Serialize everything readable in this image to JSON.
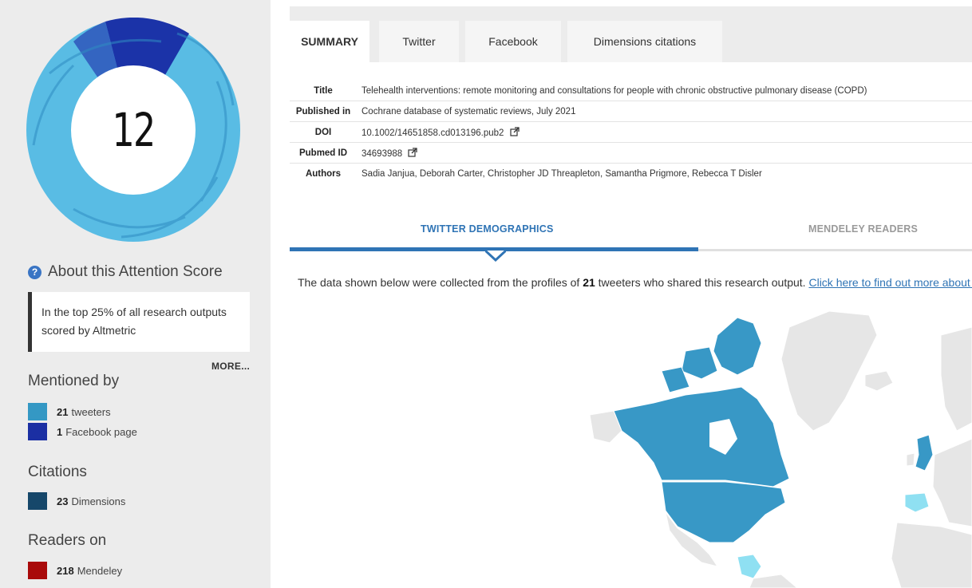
{
  "score": "12",
  "about_title": "About this Attention Score",
  "rank_text": "In the top 25% of all research outputs scored by Altmetric",
  "more_label": "MORE...",
  "mentioned": {
    "title": "Mentioned by",
    "items": [
      {
        "count": "21",
        "label": "tweeters",
        "color": "#3498c4"
      },
      {
        "count": "1",
        "label": "Facebook page",
        "color": "#1b2fa3"
      }
    ]
  },
  "citations": {
    "title": "Citations",
    "items": [
      {
        "count": "23",
        "label": "Dimensions",
        "color": "#16476a"
      }
    ]
  },
  "readers": {
    "title": "Readers on",
    "items": [
      {
        "count": "218",
        "label": "Mendeley",
        "color": "#a90a0a"
      }
    ]
  },
  "tabs": [
    "SUMMARY",
    "Twitter",
    "Facebook",
    "Dimensions citations"
  ],
  "info": [
    {
      "label": "Title",
      "value": "Telehealth interventions: remote monitoring and consultations for people with chronic obstructive pulmonary disease (COPD)"
    },
    {
      "label": "Published in",
      "value": "Cochrane database of systematic reviews, July 2021"
    },
    {
      "label": "DOI",
      "value": "10.1002/14651858.cd013196.pub2"
    },
    {
      "label": "Pubmed ID",
      "value": "34693988"
    },
    {
      "label": "Authors",
      "value": "Sadia Janjua, Deborah Carter, Christopher JD Threapleton, Samantha Prigmore, Rebecca T Disler"
    }
  ],
  "demo_tabs": [
    "TWITTER DEMOGRAPHICS",
    "MENDELEY READERS"
  ],
  "collected": {
    "prefix": "The data shown below were collected from the profiles of ",
    "count": "21",
    "suffix": " tweeters who shared this research output. ",
    "link": "Click here to find out more about how the information was compiled."
  },
  "colors": {
    "map_high": "#3898c6",
    "map_low": "#8fe0f2",
    "map_none": "#e6e6e6",
    "accent": "#2f74b5"
  }
}
